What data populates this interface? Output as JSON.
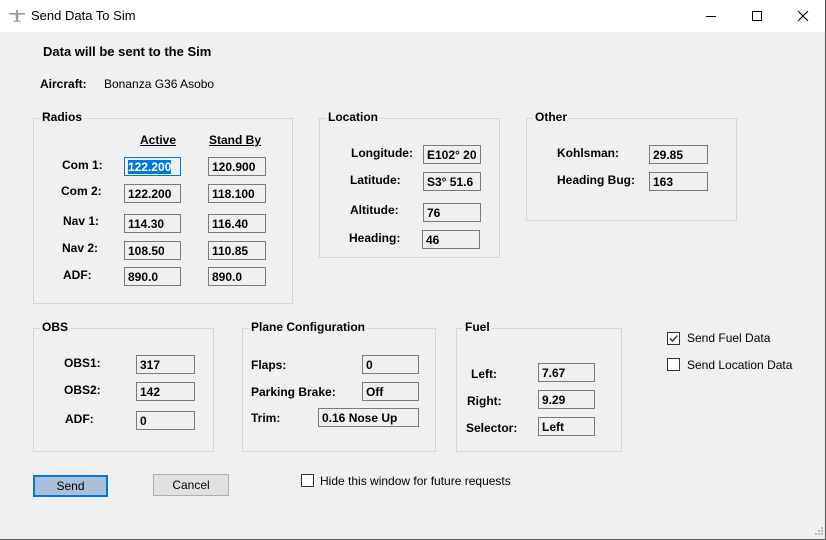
{
  "window": {
    "title": "Send Data To Sim",
    "icon": "airplane-icon",
    "controls": {
      "minimize": "minimize-icon",
      "maximize": "maximize-icon",
      "close": "close-icon"
    }
  },
  "header": {
    "message": "Data will be sent to the Sim",
    "aircraft_label": "Aircraft:",
    "aircraft_value": "Bonanza G36 Asobo"
  },
  "radios": {
    "title": "Radios",
    "col_active": "Active",
    "col_standby": "Stand By",
    "rows": [
      {
        "label": "Com 1:",
        "active": "122.200",
        "standby": "120.900"
      },
      {
        "label": "Com 2:",
        "active": "122.200",
        "standby": "118.100"
      },
      {
        "label": "Nav 1:",
        "active": "114.30",
        "standby": "116.40"
      },
      {
        "label": "Nav 2:",
        "active": "108.50",
        "standby": "110.85"
      },
      {
        "label": "ADF:",
        "active": "890.0",
        "standby": "890.0"
      }
    ]
  },
  "location": {
    "title": "Location",
    "rows": [
      {
        "label": "Longitude:",
        "value": "E102° 20"
      },
      {
        "label": "Latitude:",
        "value": "S3° 51.6"
      },
      {
        "label": "Altitude:",
        "value": "76"
      },
      {
        "label": "Heading:",
        "value": "46"
      }
    ]
  },
  "other": {
    "title": "Other",
    "rows": [
      {
        "label": "Kohlsman:",
        "value": "29.85"
      },
      {
        "label": "Heading Bug:",
        "value": "163"
      }
    ]
  },
  "obs": {
    "title": "OBS",
    "rows": [
      {
        "label": "OBS1:",
        "value": "317"
      },
      {
        "label": "OBS2:",
        "value": "142"
      },
      {
        "label": "ADF:",
        "value": "0"
      }
    ]
  },
  "plane_config": {
    "title": "Plane Configuration",
    "rows": [
      {
        "label": "Flaps:",
        "value": "0"
      },
      {
        "label": "Parking Brake:",
        "value": "Off"
      },
      {
        "label": "Trim:",
        "value": "0.16 Nose Up"
      }
    ]
  },
  "fuel": {
    "title": "Fuel",
    "rows": [
      {
        "label": "Left:",
        "value": "7.67"
      },
      {
        "label": "Right:",
        "value": "9.29"
      },
      {
        "label": "Selector:",
        "value": "Left"
      }
    ]
  },
  "options": {
    "send_fuel": {
      "label": "Send Fuel Data",
      "checked": true
    },
    "send_location": {
      "label": "Send Location Data",
      "checked": false
    },
    "hide_window": {
      "label": "Hide this window for future requests",
      "checked": false
    }
  },
  "buttons": {
    "send": "Send",
    "cancel": "Cancel"
  }
}
